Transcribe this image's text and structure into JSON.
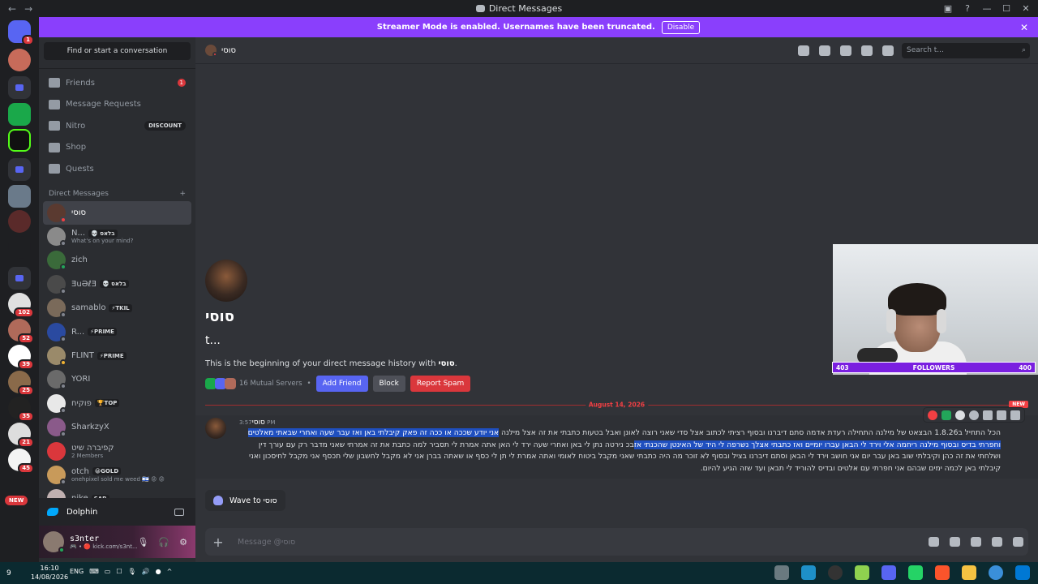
{
  "window": {
    "title": "Direct Messages",
    "nav_back": "←",
    "nav_forward": "→",
    "controls": [
      "▣",
      "?",
      "—",
      "☐",
      "✕"
    ]
  },
  "banner": {
    "text": "Streamer Mode is enabled. Usernames have been truncated.",
    "disable_label": "Disable",
    "close": "✕"
  },
  "servers": {
    "home_badge": "1",
    "badges": [
      "102",
      "52",
      "39",
      "25",
      "35",
      "21",
      "45"
    ],
    "new_label": "NEW"
  },
  "sidebar": {
    "search_label": "Find or start a conversation",
    "nav": [
      {
        "label": "Friends",
        "badge": "1"
      },
      {
        "label": "Message Requests"
      },
      {
        "label": "Nitro",
        "badge": "DISCOUNT"
      },
      {
        "label": "Shop"
      },
      {
        "label": "Quests"
      }
    ],
    "dm_header": "Direct Messages",
    "dm_add": "+",
    "dms": [
      {
        "name": "סוסי",
        "sub": "",
        "tag": "",
        "status": "#f23f43"
      },
      {
        "name": "N...",
        "sub": "What's on your mind?",
        "tag": "💀 בלאס",
        "status": "#80848e"
      },
      {
        "name": "zich",
        "sub": "",
        "tag": "",
        "status": "#23a55a"
      },
      {
        "name": "ƎuƏℓƎ",
        "sub": "",
        "tag": "💀 בלאס",
        "status": "#80848e"
      },
      {
        "name": "samablo",
        "sub": "",
        "tag": "⚡TKIL",
        "status": "#80848e"
      },
      {
        "name": "R...",
        "sub": "",
        "tag": "⚡PRIME",
        "status": "#80848e"
      },
      {
        "name": "FLINT",
        "sub": "",
        "tag": "⚡PRIME",
        "status": "#f0b232"
      },
      {
        "name": "YORI",
        "sub": "",
        "tag": "",
        "status": "#80848e"
      },
      {
        "name": "פוקיח",
        "sub": "",
        "tag": "🏆TOP",
        "status": "#80848e"
      },
      {
        "name": "SharkzyX",
        "sub": "",
        "tag": "",
        "status": "#80848e"
      },
      {
        "name": "קפיברה שיט",
        "sub": "2 Members",
        "tag": "",
        "status": ""
      },
      {
        "name": "otch",
        "sub": "onehpixel sold me weed 🇮🇱 😡 😡",
        "tag": "😀GOLD",
        "status": "#80848e"
      },
      {
        "name": "nike",
        "sub": "",
        "tag": "SAB",
        "status": "#80848e"
      }
    ]
  },
  "activity": {
    "name": "Dolphin"
  },
  "user": {
    "name": "s3nter",
    "status": "🎮 • 🔴 kick.com/s3nt..."
  },
  "header": {
    "channel_name": "סוסי",
    "search_placeholder": "Search t...",
    "search_icon": "⌕"
  },
  "profile": {
    "name": "סוסי",
    "handle": "t...",
    "beginning_prefix": "This is the beginning of your direct message history with ",
    "beginning_name": "סוסי",
    "beginning_suffix": ".",
    "mutual_servers": "16 Mutual Servers",
    "dot": "•",
    "add_friend": "Add Friend",
    "block": "Block",
    "report": "Report Spam"
  },
  "divider": {
    "date": "August 14, 2026",
    "new_label": "NEW"
  },
  "message": {
    "author": "סוסי",
    "time": "3:57 PM",
    "text_plain": "הכל התחיל ב1.8.26 הבצאט של מילנה התחילה רעדת אדמה סתם דיברנו ובסוף רציתי לכתוב אצל סדי שאני רוצה לאונן ואבל בטעות כתבתי את זה אצל מילנה ",
    "text_highlight": "אני יודע שככה או ככה זה פאק קיבלתי באן ואז עבר שעה ואחרי שבאתי מאלטים וחפרתי בדיס ובסוף מילנה ריחמה אלי וירד לי הבאן עברו יומיים ואז כתבתי אצלך נשרפה לי היד של האינטן שהכנתי אז",
    "text_rest": "בכ נירטה נתן לי באן ואחרי שעה ירד לי האן אתה אמרת לי תסביר למה כתבת את זה אמרתי שאני מדבר רק עם עורך דין ושלחתי את זה כהן וקיבלתי שוב באן עבר יום אני חושב וירד לי הבאן וסתם דיברנו בציל ובסוף לא זוכר מה היה כתבתי שאני מקבל ביטוח לאומי ואתה אמרת לי תן לי כסף או שאתה בברן אני לא מקבל לחשבון שלי תכסף אני מקבל לחיסכון ואני קיבלתי באן לכמה ימים שבהם אני חפרתי עם אלטים ובדיס להוריד לי תבאן ועד שזה הגיע להיום."
  },
  "wave": {
    "label": "Wave to סוסי"
  },
  "composer": {
    "placeholder": "Message @סוסי",
    "plus": "+"
  },
  "stream_overlay": {
    "followers_label": "FOLLOWERS",
    "left_count": "403",
    "right_count": "400"
  },
  "taskbar": {
    "weather": "9",
    "time": "16:10",
    "date": "14/08/2026",
    "tray": [
      "ENG",
      "⌨",
      "▭",
      "☐",
      "🎙",
      "🔊",
      "●",
      "^"
    ]
  }
}
